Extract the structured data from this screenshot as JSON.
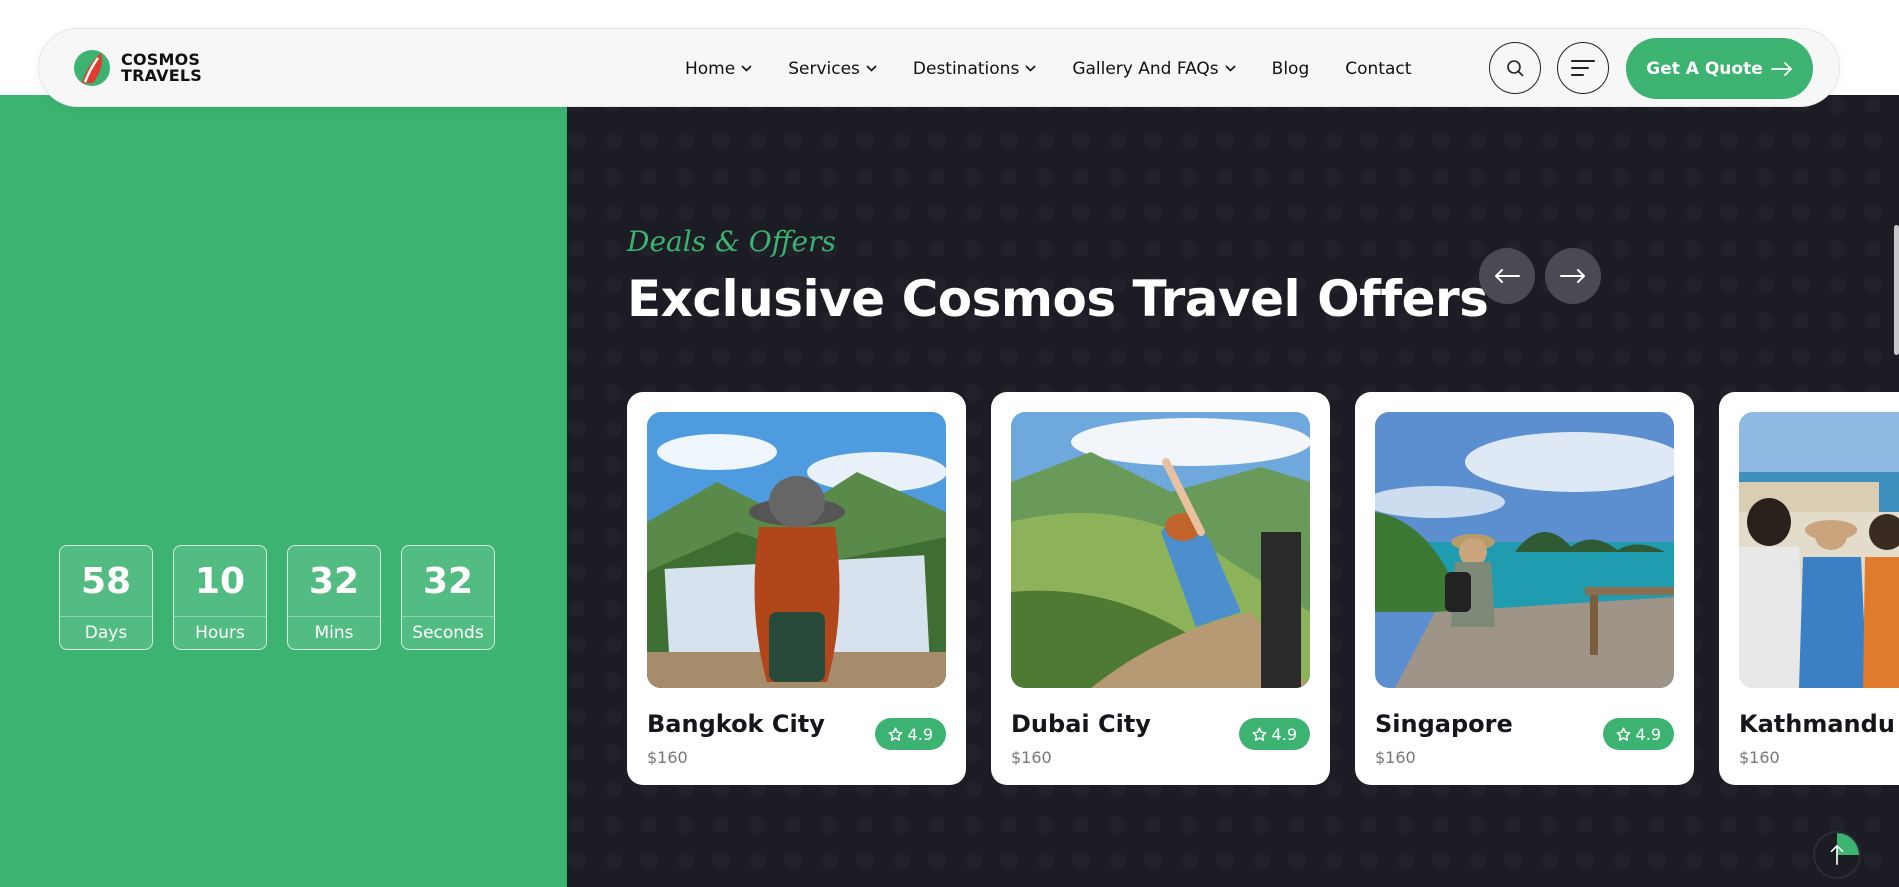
{
  "header": {
    "logo_line1": "COSMOS",
    "logo_line2": "TRAVELS",
    "nav": [
      {
        "label": "Home",
        "dropdown": true
      },
      {
        "label": "Services",
        "dropdown": true
      },
      {
        "label": "Destinations",
        "dropdown": true
      },
      {
        "label": "Gallery And FAQs",
        "dropdown": true
      },
      {
        "label": "Blog",
        "dropdown": false
      },
      {
        "label": "Contact",
        "dropdown": false
      }
    ],
    "cta_label": "Get A Quote"
  },
  "countdown": [
    {
      "value": "58",
      "label": "Days"
    },
    {
      "value": "10",
      "label": "Hours"
    },
    {
      "value": "32",
      "label": "Mins"
    },
    {
      "value": "32",
      "label": "Seconds"
    }
  ],
  "offers": {
    "subtitle": "Deals & Offers",
    "title": "Exclusive Cosmos Travel Offers",
    "cards": [
      {
        "name": "Bangkok City",
        "price": "$160",
        "rating": "4.9"
      },
      {
        "name": "Dubai City",
        "price": "$160",
        "rating": "4.9"
      },
      {
        "name": "Singapore",
        "price": "$160",
        "rating": "4.9"
      },
      {
        "name": "Kathmandu V",
        "price": "$160",
        "rating": ""
      }
    ]
  },
  "colors": {
    "accent": "#3cb371",
    "dark": "#1c1d24"
  },
  "icons": [
    "chevron-down-icon",
    "search-icon",
    "menu-icon",
    "arrow-right-icon",
    "arrow-left-icon",
    "star-icon",
    "arrow-up-icon"
  ]
}
